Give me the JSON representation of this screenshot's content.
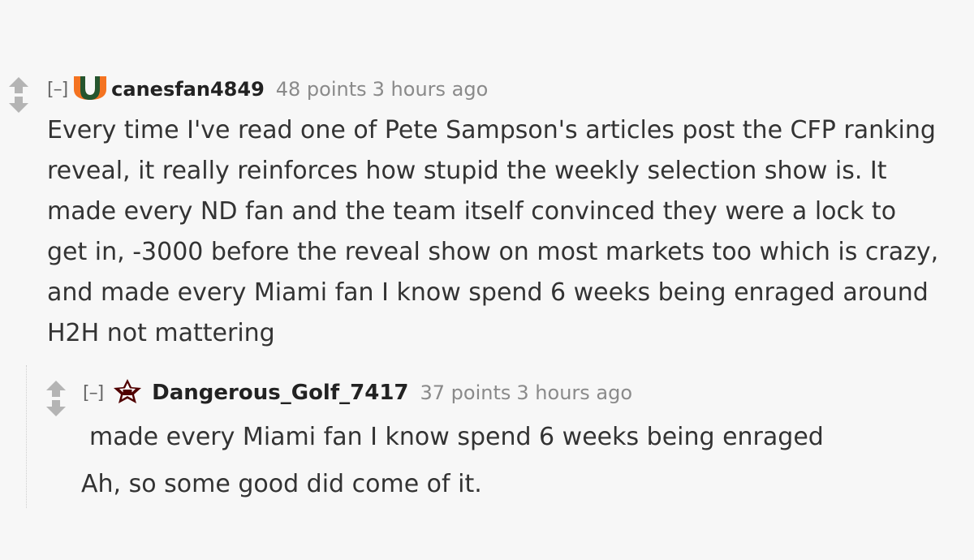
{
  "comments": [
    {
      "collapse_label": "[–]",
      "flair_icon": "miami-u-logo-icon",
      "author": "canesfan4849",
      "points": "48 points",
      "time": "3 hours ago",
      "body": [
        "Every time I've read one of Pete Sampson's articles post the CFP ranking",
        "reveal, it really reinforces how stupid the weekly selection show is. It",
        "made every ND fan and the team itself convinced they were a lock to",
        "get in, -3000 before the reveal show on most markets too which is crazy,",
        "and made every Miami fan I know spend 6 weeks being enraged around",
        "H2H not mattering"
      ]
    },
    {
      "collapse_label": "[–]",
      "flair_icon": "texas-am-logo-icon",
      "author": "Dangerous_Golf_7417",
      "points": "37 points",
      "time": "3 hours ago",
      "quote": "made every Miami fan I know spend 6 weeks being enraged",
      "body": [
        "Ah, so some good did come of it."
      ]
    }
  ],
  "colors": {
    "background": "#f7f7f7",
    "miami_orange": "#f47321",
    "miami_green": "#005030",
    "aggie_maroon": "#500000",
    "vote_arrow": "#b4b4b4"
  }
}
